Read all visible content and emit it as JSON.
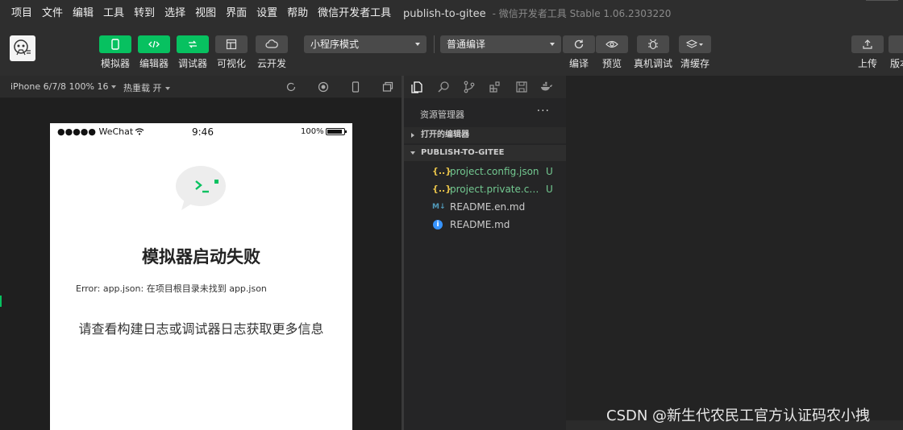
{
  "menu": [
    "项目",
    "文件",
    "编辑",
    "工具",
    "转到",
    "选择",
    "视图",
    "界面",
    "设置",
    "帮助",
    "微信开发者工具"
  ],
  "window": {
    "title": "publish-to-gitee",
    "subtitle": "- 微信开发者工具 Stable 1.06.2303220"
  },
  "toolbar": {
    "simulator": "模拟器",
    "editor": "编辑器",
    "debugger": "调试器",
    "visual": "可视化",
    "cloud": "云开发",
    "mode_select": "小程序模式",
    "compile_select": "普通编译",
    "compile": "编译",
    "preview": "预览",
    "real_debug": "真机调试",
    "clear_cache": "清缓存",
    "upload": "上传",
    "version": "版本"
  },
  "simulator": {
    "device": "iPhone 6/7/8 100% 16",
    "hot_reload": "热重载 开",
    "carrier": "●●●●● WeChat",
    "time": "9:46",
    "battery": "100%",
    "error_title": "模拟器启动失败",
    "error_message": "Error: app.json: 在项目根目录未找到 app.json",
    "error_hint": "请查看构建日志或调试器日志获取更多信息"
  },
  "explorer": {
    "title": "资源管理器",
    "more": "···",
    "open_editors": "打开的编辑器",
    "project": "PUBLISH-TO-GITEE",
    "files": [
      {
        "icon": "{..}",
        "name": "project.config.json",
        "status": "U"
      },
      {
        "icon": "{..}",
        "name": "project.private.config.json",
        "status": "U"
      },
      {
        "icon": "M↓",
        "name": "README.en.md",
        "status": ""
      },
      {
        "icon": "i",
        "name": "README.md",
        "status": ""
      }
    ]
  },
  "watermark": "CSDN @新生代农民工官方认证码农小拽",
  "colors": {
    "accent_green": "#07c160",
    "git_untracked": "#73c991",
    "json_icon": "#e8c34a",
    "md_icon": "#519aba",
    "info_icon": "#3794ff"
  }
}
